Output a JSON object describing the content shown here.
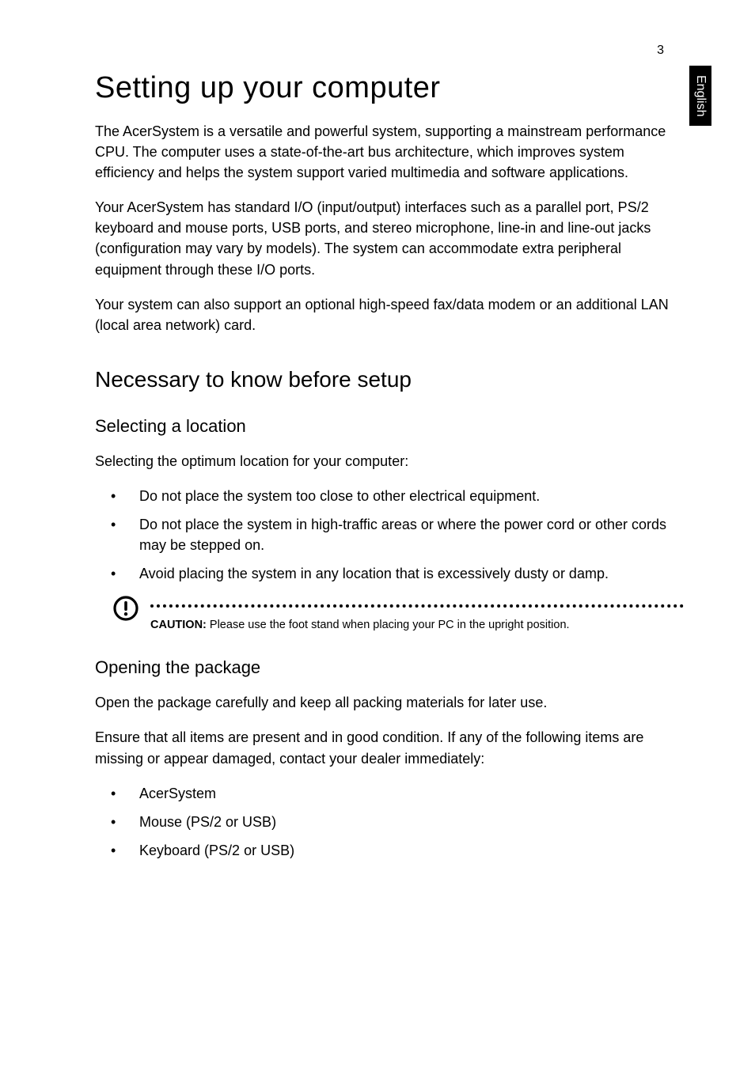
{
  "page_number": "3",
  "language_tab": "English",
  "title": "Setting up your computer",
  "intro_paragraphs": [
    "The AcerSystem is a versatile and powerful system, supporting a mainstream performance CPU. The computer uses a state-of-the-art bus architecture, which improves system efficiency and helps the system support varied multimedia and software applications.",
    "Your AcerSystem has standard I/O (input/output) interfaces such as a parallel port, PS/2 keyboard and mouse ports, USB ports, and stereo microphone, line-in and line-out jacks (configuration may vary by models). The system can accommodate extra peripheral equipment through these I/O ports.",
    "Your system can also support an optional high-speed fax/data modem or an additional LAN (local area network) card."
  ],
  "section_heading": "Necessary to know before setup",
  "subsection_location": {
    "heading": "Selecting a location",
    "lead": "Selecting the optimum location for your computer:",
    "bullets": [
      "Do not place the system too close to other electrical equipment.",
      "Do not place the system in high-traffic areas or where the power cord or other cords may be stepped on.",
      "Avoid placing the system in any location that is excessively dusty or damp."
    ]
  },
  "caution": {
    "label": "CAUTION:",
    "text": " Please use the foot stand when placing your PC in the upright position."
  },
  "subsection_package": {
    "heading": "Opening the package",
    "paragraphs": [
      "Open the package carefully and keep all packing materials for later use.",
      "Ensure that all items are present and in good condition. If any of the following items are missing or appear damaged, contact your dealer immediately:"
    ],
    "bullets": [
      "AcerSystem",
      "Mouse (PS/2 or USB)",
      "Keyboard (PS/2 or USB)"
    ]
  }
}
